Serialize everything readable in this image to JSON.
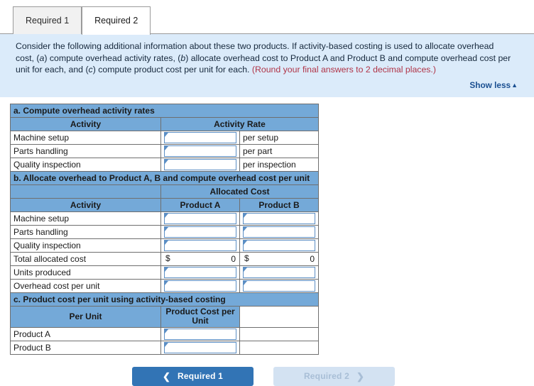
{
  "tabs": [
    {
      "label": "Required 1",
      "active": false
    },
    {
      "label": "Required 2",
      "active": true
    }
  ],
  "instructions": {
    "text_part1": "Consider the following additional information about these two products. If activity-based costing is used to allocate overhead cost, (",
    "italic_a": "a",
    "text_part2": ") compute overhead activity rates, (",
    "italic_b": "b",
    "text_part3": ") allocate overhead cost to Product A and Product B and compute overhead cost per unit for each, and (",
    "italic_c": "c",
    "text_part4": ") compute product cost per unit for each. ",
    "highlight": "(Round your final answers to 2 decimal places.)",
    "show_less_label": "Show less",
    "show_less_caret": "▲"
  },
  "sheet": {
    "section_a": {
      "title": "a. Compute overhead activity rates",
      "col_activity": "Activity",
      "col_rate": "Activity Rate",
      "rows": [
        {
          "activity": "Machine setup",
          "rate_value": "",
          "unit": "per setup"
        },
        {
          "activity": "Parts handling",
          "rate_value": "",
          "unit": "per part"
        },
        {
          "activity": "Quality inspection",
          "rate_value": "",
          "unit": "per inspection"
        }
      ]
    },
    "section_b": {
      "title": "b. Allocate overhead to Product A, B and compute overhead cost per unit",
      "group_header": "Allocated Cost",
      "col_activity": "Activity",
      "col_product_a": "Product A",
      "col_product_b": "Product B",
      "rows": [
        {
          "activity": "Machine setup",
          "a_value": "",
          "b_value": ""
        },
        {
          "activity": "Parts handling",
          "a_value": "",
          "b_value": ""
        },
        {
          "activity": "Quality inspection",
          "a_value": "",
          "b_value": ""
        }
      ],
      "total_row": {
        "label": "Total allocated cost",
        "a_currency": "$",
        "a_amount": "0",
        "b_currency": "$",
        "b_amount": "0"
      },
      "units_row": {
        "label": "Units produced",
        "a_value": "",
        "b_value": ""
      },
      "per_unit_row": {
        "label": "Overhead cost per unit",
        "a_value": "",
        "b_value": ""
      }
    },
    "section_c": {
      "title": "c. Product cost per unit using activity-based costing",
      "col_per_unit": "Per Unit",
      "col_product_cost": "Product Cost per Unit",
      "rows": [
        {
          "label": "Product A",
          "value": ""
        },
        {
          "label": "Product B",
          "value": ""
        }
      ]
    }
  },
  "footer": {
    "prev_label": "Required 1",
    "prev_chevron": "❮",
    "next_label": "Required 2",
    "next_chevron": "❯"
  },
  "colors": {
    "header_blue": "#74a9d8",
    "panel_blue": "#dbebfa",
    "accent_red": "#b03447",
    "link_blue": "#1a4f91",
    "button_blue": "#3274b5",
    "button_disabled": "#d3e2f2"
  }
}
